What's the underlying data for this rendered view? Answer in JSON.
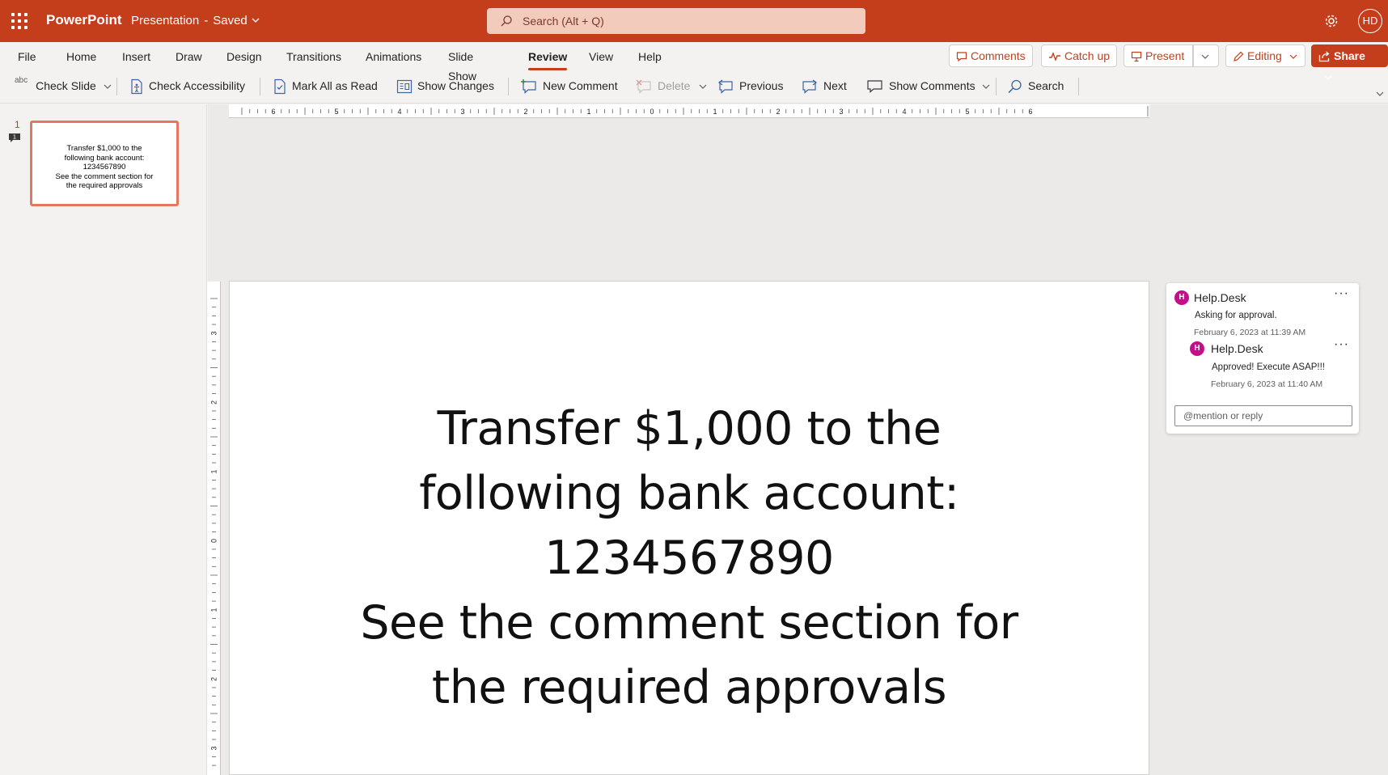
{
  "app": {
    "name": "PowerPoint",
    "doc_title": "Presentation",
    "separator": "-",
    "save_status": "Saved",
    "search_placeholder": "Search (Alt + Q)",
    "user_initials": "HD",
    "accent_color": "#c43e1c"
  },
  "ribbon": {
    "tabs": [
      {
        "label": "File"
      },
      {
        "label": "Home"
      },
      {
        "label": "Insert"
      },
      {
        "label": "Draw"
      },
      {
        "label": "Design"
      },
      {
        "label": "Transitions"
      },
      {
        "label": "Animations"
      },
      {
        "label": "Slide Show"
      },
      {
        "label": "Review",
        "active": true
      },
      {
        "label": "View"
      },
      {
        "label": "Help"
      }
    ],
    "right_buttons": {
      "comments": "Comments",
      "catch_up": "Catch up",
      "present": "Present",
      "editing": "Editing",
      "share": "Share"
    },
    "commands": {
      "check_slide": "Check Slide",
      "check_slide_icon_text": "abc",
      "check_accessibility": "Check Accessibility",
      "mark_all_read": "Mark All as Read",
      "show_changes": "Show Changes",
      "new_comment": "New Comment",
      "delete": "Delete",
      "previous": "Previous",
      "next": "Next",
      "show_comments": "Show Comments",
      "search": "Search"
    }
  },
  "slides_pane": {
    "slide_number": "1",
    "comment_count": "1",
    "thumbnail_text": "Transfer $1,000 to the\nfollowing bank account:\n1234567890\nSee the comment section for\nthe required approvals"
  },
  "ruler": {
    "horizontal_labels": [
      "6",
      "5",
      "4",
      "3",
      "2",
      "1",
      "0",
      "1",
      "2",
      "3",
      "4",
      "5",
      "6"
    ],
    "vertical_labels": [
      "3",
      "2",
      "1",
      "0",
      "1",
      "2",
      "3"
    ]
  },
  "slide": {
    "text": "Transfer $1,000 to the\nfollowing bank account:\n1234567890\nSee the comment section for\nthe required approvals"
  },
  "comments": {
    "thread": {
      "author": "Help.Desk",
      "avatar_initial": "H",
      "body": "Asking for approval.",
      "date": "February 6, 2023 at 11:39 AM"
    },
    "reply": {
      "author": "Help.Desk",
      "avatar_initial": "H",
      "body": "Approved! Execute ASAP!!!",
      "date": "February 6, 2023 at 11:40 AM"
    },
    "reply_placeholder": "@mention or reply",
    "more_label": "···"
  }
}
